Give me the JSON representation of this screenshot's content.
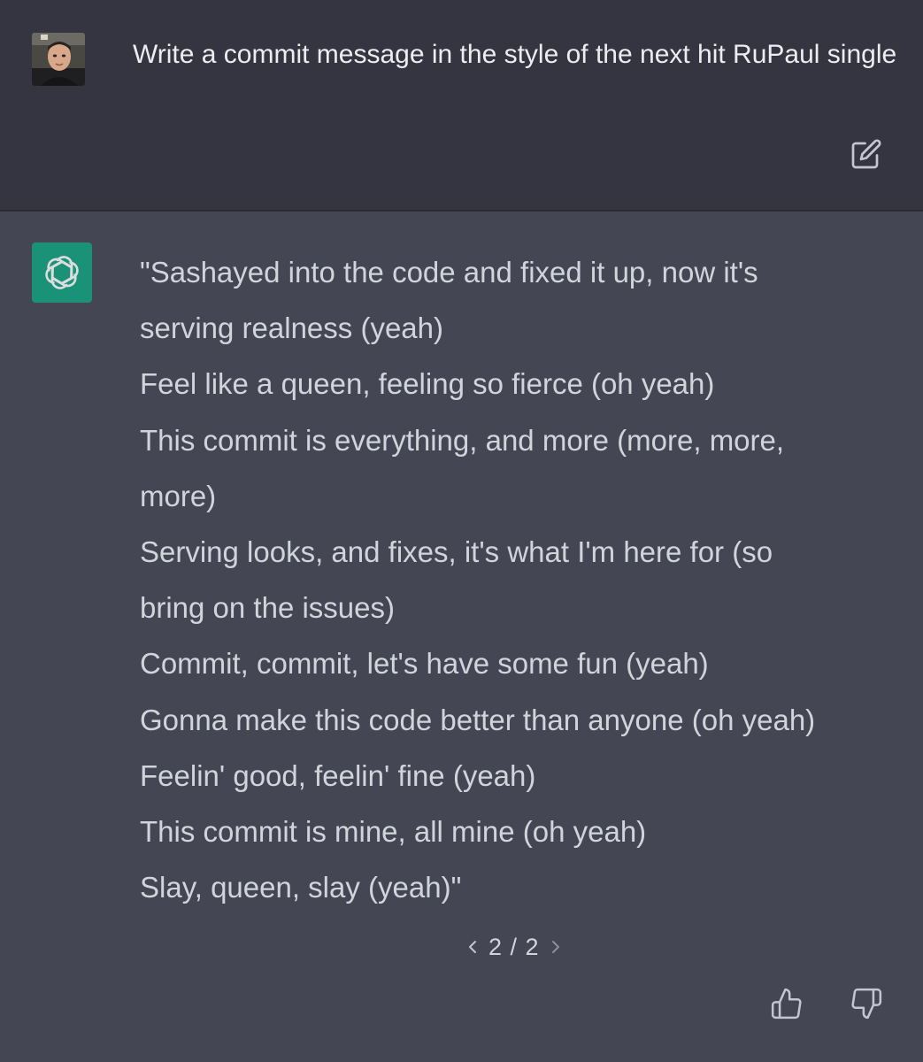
{
  "user_message": {
    "text": "Write a commit message in the style of the next hit RuPaul single",
    "avatar_icon": "user-avatar-photo",
    "edit_icon": "edit-icon"
  },
  "assistant_message": {
    "avatar_icon": "openai-logo-icon",
    "lines": [
      "\"Sashayed into the code and fixed it up, now it's",
      "serving realness (yeah)",
      "Feel like a queen, feeling so fierce (oh yeah)",
      "This commit is everything, and more (more, more,",
      "more)",
      "Serving looks, and fixes, it's what I'm here for (so",
      "bring on the issues)",
      "Commit, commit, let's have some fun (yeah)",
      "Gonna make this code better than anyone (oh yeah)",
      "Feelin' good, feelin' fine (yeah)",
      "This commit is mine, all mine (oh yeah)",
      "Slay, queen, slay (yeah)\""
    ],
    "pager": {
      "prev_icon": "chevron-left-icon",
      "label": "2 / 2",
      "next_icon": "chevron-right-icon"
    },
    "feedback": {
      "thumbs_up_icon": "thumbs-up-icon",
      "thumbs_down_icon": "thumbs-down-icon"
    }
  },
  "colors": {
    "user_bg": "#343541",
    "assistant_bg": "#444654",
    "brand_green": "#10a37f",
    "text": "#d1d5db"
  }
}
